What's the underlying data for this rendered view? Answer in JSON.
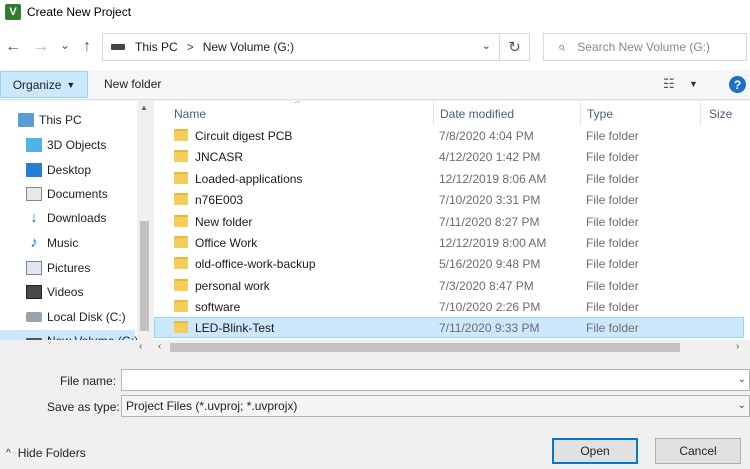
{
  "window": {
    "title": "Create New Project",
    "app_icon_glyph": "V"
  },
  "nav": {
    "back_icon": "←",
    "forward_icon": "→",
    "recent_icon": "⌄",
    "up_icon": "↑",
    "breadcrumb": [
      "This PC",
      "New Volume (G:)"
    ],
    "breadcrumb_sep": ">",
    "address_dropdown_icon": "⌄",
    "refresh_icon": "↻",
    "search_placeholder": "Search New Volume (G:)",
    "search_icon": "⌕"
  },
  "toolbar": {
    "organize_label": "Organize",
    "organize_caret": "▼",
    "new_folder_label": "New folder",
    "view_icon": "☷",
    "view_caret": "▼",
    "help_label": "?"
  },
  "sidebar": {
    "items": [
      {
        "label": "This PC"
      },
      {
        "label": "3D Objects"
      },
      {
        "label": "Desktop"
      },
      {
        "label": "Documents"
      },
      {
        "label": "Downloads",
        "glyph": "↓"
      },
      {
        "label": "Music",
        "glyph": "♪"
      },
      {
        "label": "Pictures"
      },
      {
        "label": "Videos"
      },
      {
        "label": "Local Disk (C:)"
      },
      {
        "label": "New Volume (G:)"
      }
    ],
    "selected_index": 9
  },
  "files": {
    "columns": {
      "name": "Name",
      "date": "Date modified",
      "type": "Type",
      "size": "Size"
    },
    "sort_caret": "^",
    "rows": [
      {
        "name": "Circuit digest PCB",
        "date": "7/8/2020 4:04 PM",
        "type": "File folder"
      },
      {
        "name": "JNCASR",
        "date": "4/12/2020 1:42 PM",
        "type": "File folder"
      },
      {
        "name": "Loaded-applications",
        "date": "12/12/2019 8:06 AM",
        "type": "File folder"
      },
      {
        "name": "n76E003",
        "date": "7/10/2020 3:31 PM",
        "type": "File folder"
      },
      {
        "name": "New folder",
        "date": "7/11/2020 8:27 PM",
        "type": "File folder"
      },
      {
        "name": "Office Work",
        "date": "12/12/2019 8:00 AM",
        "type": "File folder"
      },
      {
        "name": "old-office-work-backup",
        "date": "5/16/2020 9:48 PM",
        "type": "File folder"
      },
      {
        "name": "personal work",
        "date": "7/3/2020 8:47 PM",
        "type": "File folder"
      },
      {
        "name": "software",
        "date": "7/10/2020 2:26 PM",
        "type": "File folder"
      },
      {
        "name": "LED-Blink-Test",
        "date": "7/11/2020 9:33 PM",
        "type": "File folder"
      }
    ],
    "selected_index": 9
  },
  "form": {
    "file_name_label": "File name:",
    "file_name_value": "",
    "save_type_label": "Save as type:",
    "save_type_value": "Project Files (*.uvproj; *.uvprojx)",
    "dropdown_icon": "⌄"
  },
  "footer": {
    "hide_folders_label": "Hide Folders",
    "hide_chevron": "^",
    "open_label": "Open",
    "cancel_label": "Cancel"
  },
  "colors": {
    "selection": "#cce8ff",
    "accent": "#0078d7",
    "folder": "#f5cd5a"
  }
}
